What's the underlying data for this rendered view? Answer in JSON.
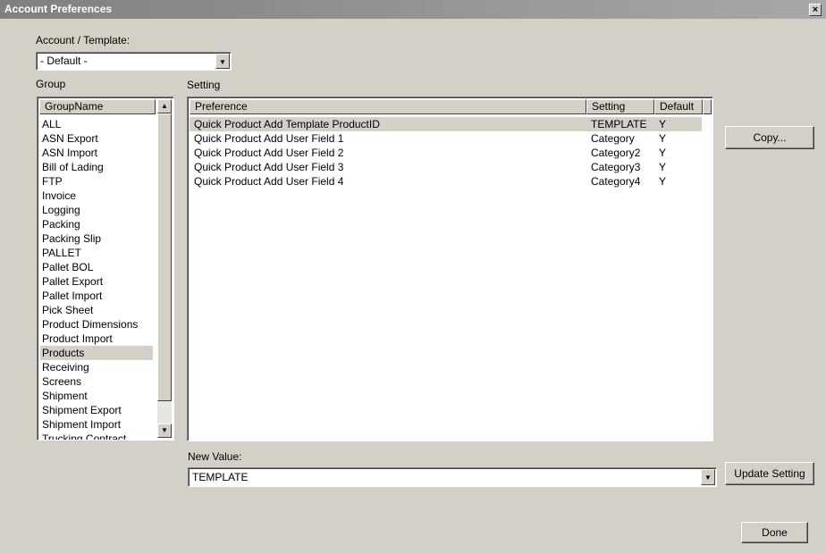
{
  "window": {
    "title": "Account Preferences",
    "close_glyph": "×"
  },
  "account": {
    "label": "Account / Template:",
    "value": "- Default -"
  },
  "group": {
    "label": "Group",
    "column_header": "GroupName",
    "selected": "Products",
    "items": [
      "ALL",
      "ASN Export",
      "ASN Import",
      "Bill of Lading",
      "FTP",
      "Invoice",
      "Logging",
      "Packing",
      "Packing Slip",
      "PALLET",
      "Pallet BOL",
      "Pallet Export",
      "Pallet Import",
      "Pick Sheet",
      "Product Dimensions",
      "Product Import",
      "Products",
      "Receiving",
      "Screens",
      "Shipment",
      "Shipment Export",
      "Shipment Import",
      "Trucking Contract"
    ]
  },
  "setting": {
    "label": "Setting",
    "columns": [
      "Preference",
      "Setting",
      "Default"
    ],
    "rows": [
      {
        "preference": "Quick Product Add Template ProductID",
        "setting": "TEMPLATE",
        "default": "Y"
      },
      {
        "preference": "Quick Product Add User Field 1",
        "setting": "Category",
        "default": "Y"
      },
      {
        "preference": "Quick Product Add User Field 2",
        "setting": "Category2",
        "default": "Y"
      },
      {
        "preference": "Quick Product Add User Field 3",
        "setting": "Category3",
        "default": "Y"
      },
      {
        "preference": "Quick Product Add User Field 4",
        "setting": "Category4",
        "default": "Y"
      }
    ]
  },
  "new_value": {
    "label": "New Value:",
    "value": "TEMPLATE"
  },
  "buttons": {
    "copy": "Copy...",
    "update": "Update Setting",
    "done": "Done"
  }
}
